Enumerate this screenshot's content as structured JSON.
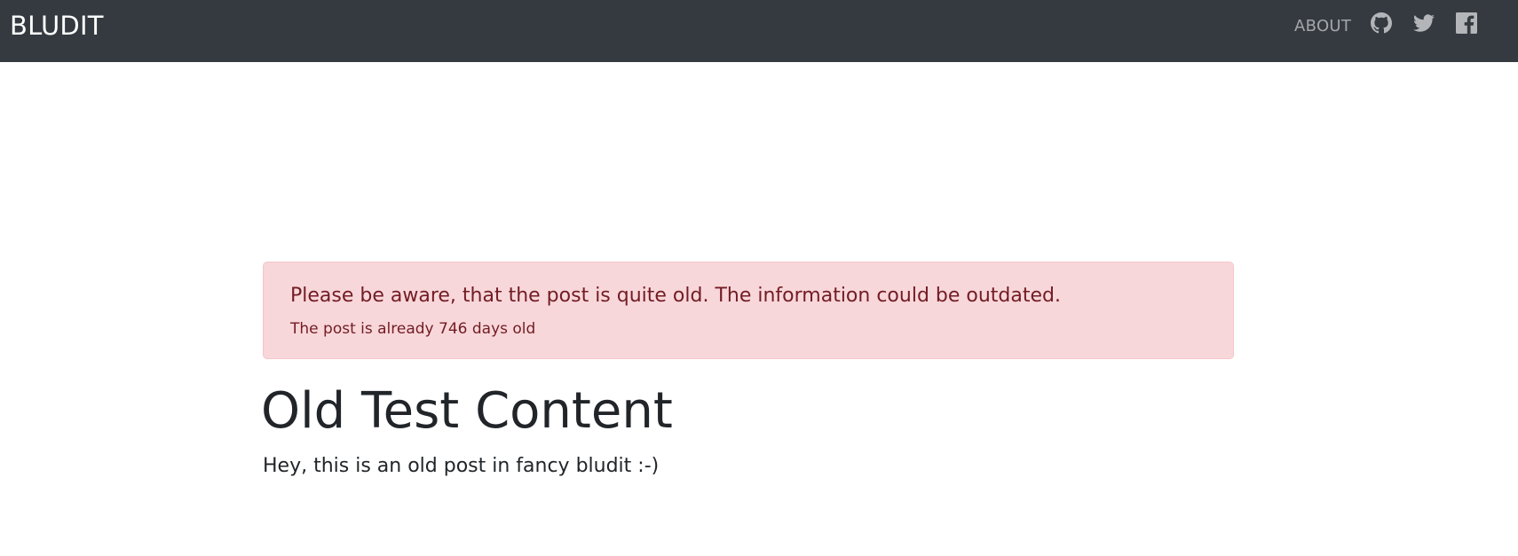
{
  "navbar": {
    "brand": "BLUDIT",
    "links": [
      {
        "label": "ABOUT"
      }
    ],
    "social_icons": [
      "github-icon",
      "twitter-icon",
      "facebook-icon"
    ],
    "colors": {
      "background": "#343a40",
      "brand": "#ffffff",
      "link": "#a0a3a6"
    }
  },
  "alert": {
    "heading": "Please be aware, that the post is quite old. The information could be outdated.",
    "message": "The post is already 746 days old",
    "colors": {
      "background": "#f8d7da",
      "border": "#f5c6cb",
      "text": "#721c24"
    }
  },
  "post": {
    "title": "Old Test Content",
    "body": "Hey, this is an old post in fancy bludit :-)"
  }
}
